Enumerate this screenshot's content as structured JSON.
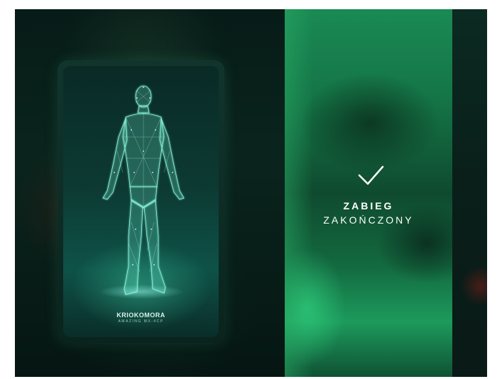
{
  "card": {
    "brand_name": "KRIOKOMORA",
    "brand_model": "AMAZING MX-4CP"
  },
  "status": {
    "line1": "ZABIEG",
    "line2": "ZAKOŃCZONY",
    "icon": "check-icon"
  },
  "colors": {
    "panel_green": "#1a8a54",
    "background_dark": "#071b17",
    "wireframe": "#7fffe0"
  }
}
